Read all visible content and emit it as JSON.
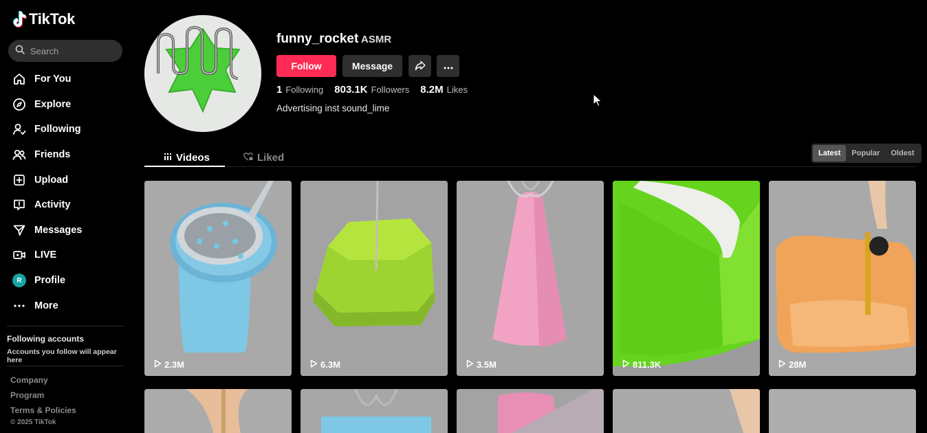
{
  "brand": {
    "name": "TikTok"
  },
  "search": {
    "placeholder": "Search"
  },
  "nav": [
    {
      "label": "For You",
      "icon": "home-icon"
    },
    {
      "label": "Explore",
      "icon": "compass-icon"
    },
    {
      "label": "Following",
      "icon": "following-icon"
    },
    {
      "label": "Friends",
      "icon": "friends-icon"
    },
    {
      "label": "Upload",
      "icon": "upload-icon"
    },
    {
      "label": "Activity",
      "icon": "activity-icon"
    },
    {
      "label": "Messages",
      "icon": "messages-icon"
    },
    {
      "label": "LIVE",
      "icon": "live-icon"
    },
    {
      "label": "Profile",
      "icon": "profile-avatar",
      "avatar_letter": "R"
    },
    {
      "label": "More",
      "icon": "more-icon"
    }
  ],
  "following_accounts": {
    "title": "Following accounts",
    "subtitle": "Accounts you follow will appear here"
  },
  "footer": {
    "links": [
      "Company",
      "Program",
      "Terms & Policies"
    ],
    "copyright": "© 2025 TikTok"
  },
  "profile": {
    "username": "funny_rocket",
    "nickname": "ASMR",
    "follow_label": "Follow",
    "message_label": "Message",
    "stats": [
      {
        "value": "1",
        "label": "Following"
      },
      {
        "value": "803.1K",
        "label": "Followers"
      },
      {
        "value": "8.2M",
        "label": "Likes"
      }
    ],
    "bio": "Advertising inst sound_lime"
  },
  "tabs": {
    "videos": "Videos",
    "liked": "Liked"
  },
  "sort": {
    "options": [
      "Latest",
      "Popular",
      "Oldest"
    ],
    "selected": "Latest"
  },
  "videos": [
    {
      "views": "2.3M"
    },
    {
      "views": "6.3M"
    },
    {
      "views": "3.5M"
    },
    {
      "views": "811.3K"
    },
    {
      "views": "28M"
    },
    {
      "views": ""
    },
    {
      "views": ""
    },
    {
      "views": ""
    },
    {
      "views": ""
    },
    {
      "views": ""
    }
  ],
  "colors": {
    "accent": "#fe2c55",
    "background": "#000000",
    "button_secondary": "#2f2f2f"
  }
}
